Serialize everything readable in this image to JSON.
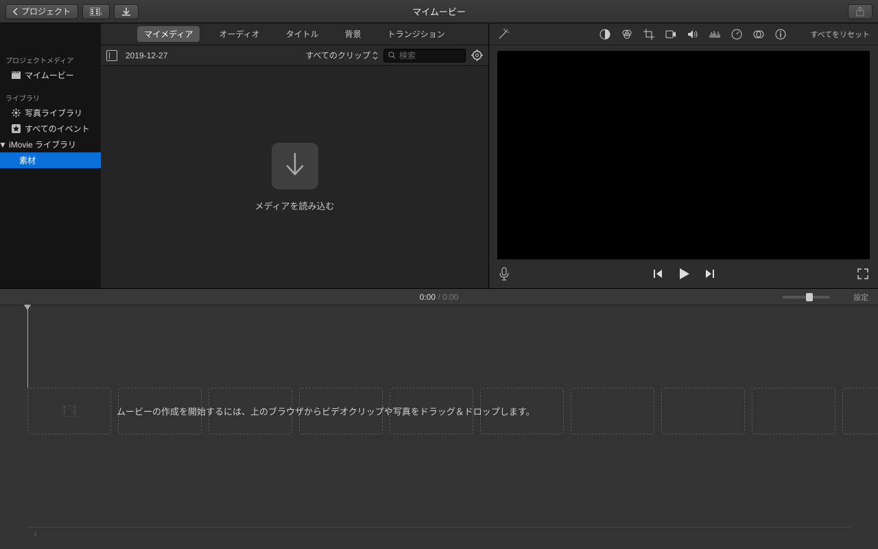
{
  "titlebar": {
    "back_label": "プロジェクト",
    "title": "マイムービー"
  },
  "sidebar": {
    "project_media_header": "プロジェクトメディア",
    "movie_label": "マイムービー",
    "library_header": "ライブラリ",
    "photo_library_label": "写真ライブラリ",
    "all_events_label": "すべてのイベント",
    "imovie_library_label": "iMovie ライブラリ",
    "event_label": "素材"
  },
  "tabs": {
    "my_media": "マイメディア",
    "audio": "オーディオ",
    "titles": "タイトル",
    "backgrounds": "背景",
    "transitions": "トランジション"
  },
  "browser": {
    "event_name": "2019-12-27",
    "filter_label": "すべてのクリップ",
    "search_placeholder": "検索",
    "import_label": "メディアを読み込む"
  },
  "viewer": {
    "reset_label": "すべてをリセット"
  },
  "timeline": {
    "current_time": "0:00",
    "total_time": "0:00",
    "settings_label": "設定",
    "hint": "ムービーの作成を開始するには、上のブラウザからビデオクリップや写真をドラッグ＆ドロップします。"
  }
}
